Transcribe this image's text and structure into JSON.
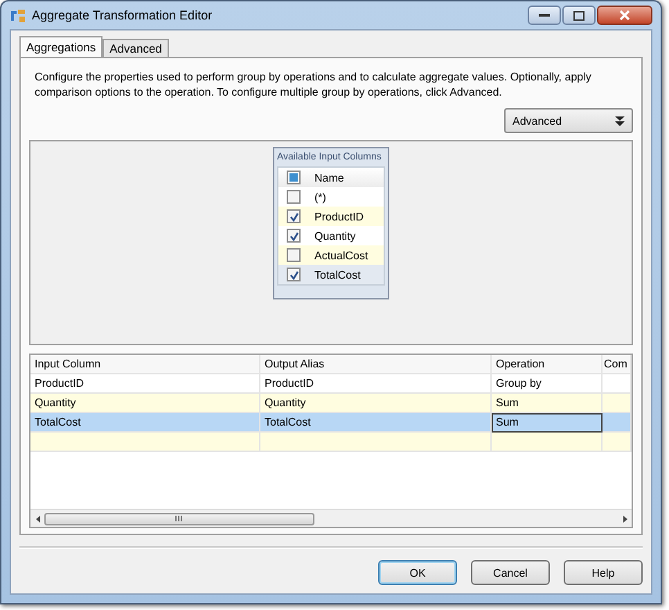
{
  "window": {
    "title": "Aggregate Transformation Editor"
  },
  "tabs": [
    {
      "label": "Aggregations",
      "selected": true
    },
    {
      "label": "Advanced",
      "selected": false
    }
  ],
  "description": "Configure the properties used to perform group by operations and to calculate aggregate values. Optionally, apply comparison options to the operation. To configure multiple group by operations, click Advanced.",
  "advanced_button": {
    "label": "Advanced"
  },
  "column_list": {
    "title": "Available Input Columns",
    "header": "Name",
    "header_indeterminate": true,
    "items": [
      {
        "name": "(*)",
        "checked": false,
        "selected": false
      },
      {
        "name": "ProductID",
        "checked": true,
        "selected": false
      },
      {
        "name": "Quantity",
        "checked": true,
        "selected": false
      },
      {
        "name": "ActualCost",
        "checked": false,
        "selected": false
      },
      {
        "name": "TotalCost",
        "checked": true,
        "selected": true
      }
    ]
  },
  "grid": {
    "columns": [
      "Input Column",
      "Output Alias",
      "Operation",
      "Com"
    ],
    "rows": [
      {
        "cells": [
          "ProductID",
          "ProductID",
          "Group by"
        ],
        "selected": false
      },
      {
        "cells": [
          "Quantity",
          "Quantity",
          "Sum"
        ],
        "selected": false
      },
      {
        "cells": [
          "TotalCost",
          "TotalCost",
          "Sum"
        ],
        "selected": true
      }
    ]
  },
  "buttons": [
    {
      "label": "OK",
      "default": true
    },
    {
      "label": "Cancel",
      "default": false
    },
    {
      "label": "Help",
      "default": false
    }
  ]
}
